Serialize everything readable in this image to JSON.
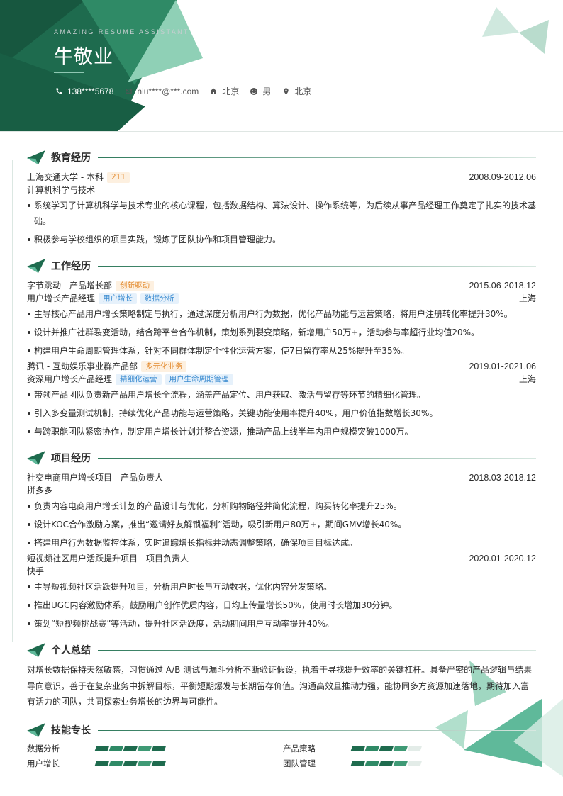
{
  "header": {
    "tagline": "AMAZING RESUME ASSISTANT",
    "name": "牛敬业",
    "contacts": [
      {
        "icon": "phone-icon",
        "text": "138****5678"
      },
      {
        "icon": "mail-icon",
        "text": "niu****@***.com"
      },
      {
        "icon": "home-icon",
        "text": "北京"
      },
      {
        "icon": "face-icon",
        "text": "男"
      },
      {
        "icon": "location-pin-icon",
        "text": "北京"
      }
    ]
  },
  "colors": {
    "primary": "#1e6b4e",
    "accent": "#5fb99a",
    "light": "#a8dcc7",
    "tag_orange": "#e38a2e",
    "tag_blue": "#3a8bd0"
  },
  "education": {
    "title": "教育经历",
    "school": "上海交通大学 - 本科",
    "badge": "211",
    "date": "2008.09-2012.06",
    "major": "计算机科学与技术",
    "bullets": [
      "系统学习了计算机科学与技术专业的核心课程，包括数据结构、算法设计、操作系统等，为后续从事产品经理工作奠定了扎实的技术基础。",
      "积极参与学校组织的项目实践，锻炼了团队协作和项目管理能力。"
    ]
  },
  "work": {
    "title": "工作经历",
    "jobs": [
      {
        "company": "字节跳动 - 产品增长部",
        "company_tag": "创新驱动",
        "date": "2015.06-2018.12",
        "role": "用户增长产品经理",
        "role_tags": [
          "用户增长",
          "数据分析"
        ],
        "city": "上海",
        "bullets": [
          "主导核心产品用户增长策略制定与执行，通过深度分析用户行为数据，优化产品功能与运营策略，将用户注册转化率提升30%。",
          "设计并推广社群裂变活动，结合跨平台合作机制，策划系列裂变策略，新增用户50万+，活动参与率超行业均值20%。",
          "构建用户生命周期管理体系，针对不同群体制定个性化运营方案，使7日留存率从25%提升至35%。"
        ]
      },
      {
        "company": "腾讯 - 互动娱乐事业群产品部",
        "company_tag": "多元化业务",
        "date": "2019.01-2021.06",
        "role": "资深用户增长产品经理",
        "role_tags": [
          "精细化运营",
          "用户生命周期管理"
        ],
        "city": "上海",
        "bullets": [
          "带领产品团队负责新产品用户增长全流程，涵盖产品定位、用户获取、激活与留存等环节的精细化管理。",
          "引入多变量测试机制，持续优化产品功能与运营策略，关键功能使用率提升40%，用户价值指数增长30%。",
          "与跨职能团队紧密协作，制定用户增长计划并整合资源，推动产品上线半年内用户规模突破1000万。"
        ]
      }
    ]
  },
  "projects": {
    "title": "项目经历",
    "items": [
      {
        "name": "社交电商用户增长项目 - 产品负责人",
        "date": "2018.03-2018.12",
        "org": "拼多多",
        "bullets": [
          "负责内容电商用户增长计划的产品设计与优化，分析购物路径并简化流程，购买转化率提升25%。",
          "设计KOC合作激励方案，推出“邀请好友解锁福利”活动，吸引新用户80万+，期间GMV增长40%。",
          "搭建用户行为数据监控体系，实时追踪增长指标并动态调整策略，确保项目目标达成。"
        ]
      },
      {
        "name": "短视频社区用户活跃提升项目 - 项目负责人",
        "date": "2020.01-2020.12",
        "org": "快手",
        "bullets": [
          "主导短视频社区活跃提升项目，分析用户时长与互动数据，优化内容分发策略。",
          "推出UGC内容激励体系，鼓励用户创作优质内容，日均上传量增长50%，使用时长增加30分钟。",
          "策划“短视频挑战赛”等活动，提升社区活跃度，活动期间用户互动率提升40%。"
        ]
      }
    ]
  },
  "summary": {
    "title": "个人总结",
    "text": "对增长数据保持天然敏感，习惯通过 A/B 测试与漏斗分析不断验证假设，执着于寻找提升效率的关键杠杆。具备严密的产品逻辑与结果导向意识，善于在复杂业务中拆解目标，平衡短期爆发与长期留存价值。沟通高效且推动力强，能协同多方资源加速落地，期待加入富有活力的团队，共同探索业务增长的边界与可能性。"
  },
  "skills": {
    "title": "技能专长",
    "items": [
      {
        "name": "数据分析",
        "level": 5,
        "max": 5
      },
      {
        "name": "产品策略",
        "level": 4,
        "max": 5
      },
      {
        "name": "用户增长",
        "level": 5,
        "max": 5
      },
      {
        "name": "团队管理",
        "level": 4,
        "max": 5
      }
    ]
  }
}
